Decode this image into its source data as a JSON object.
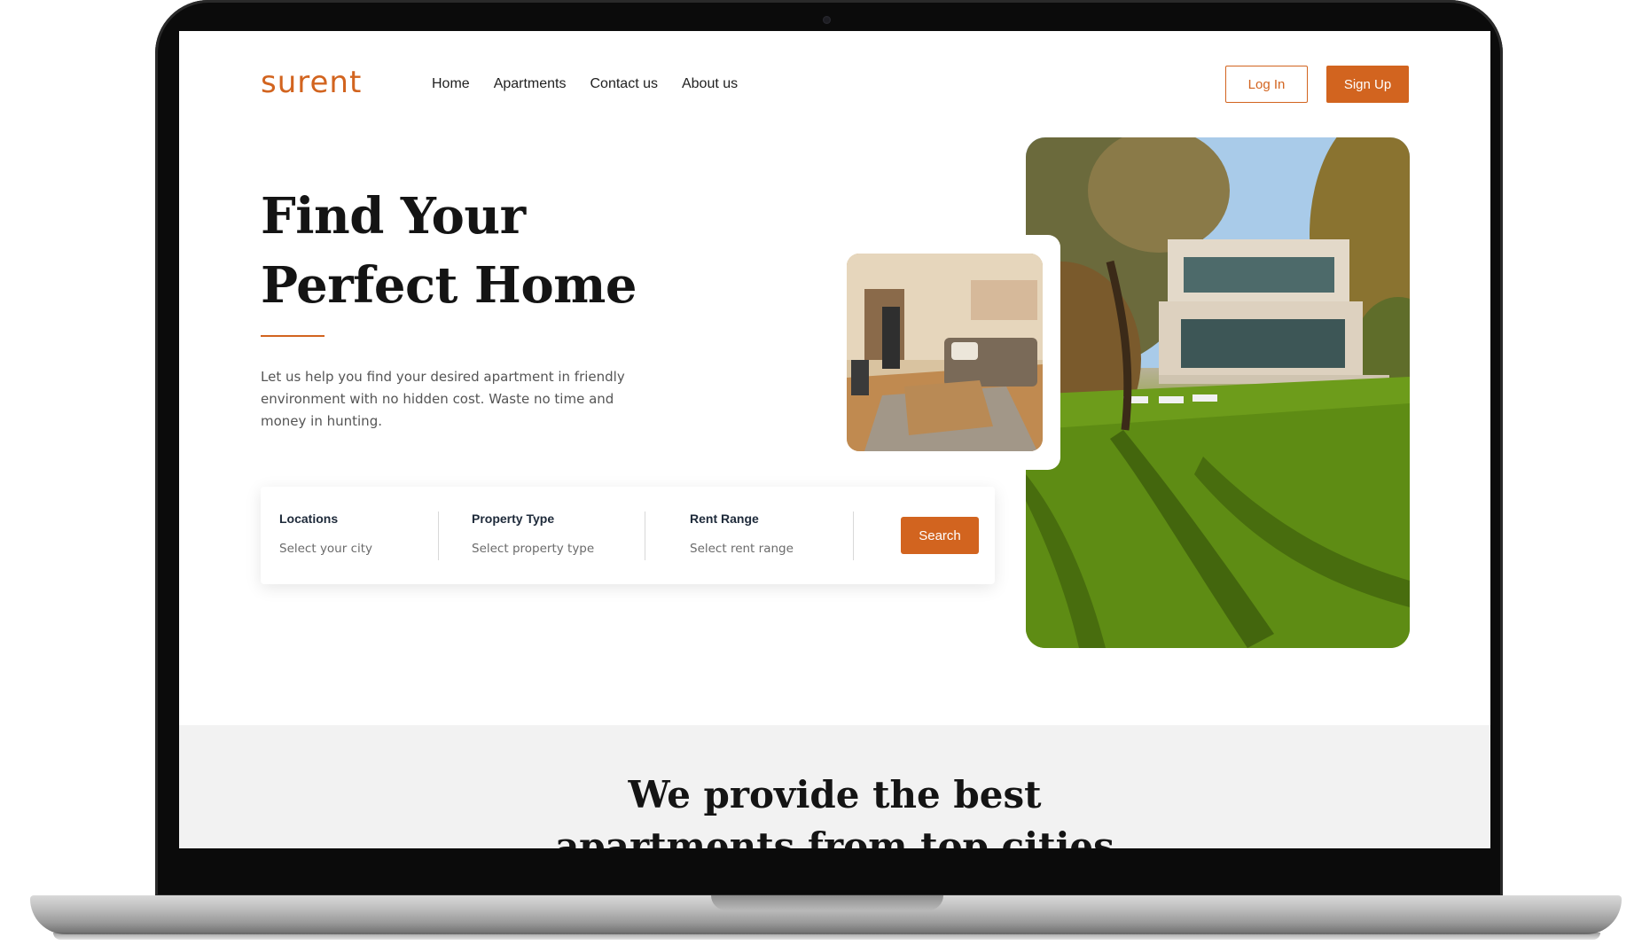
{
  "brand": {
    "logo": "surent",
    "accent_color": "#d2641f"
  },
  "nav": {
    "items": [
      {
        "label": "Home"
      },
      {
        "label": "Apartments"
      },
      {
        "label": "Contact us"
      },
      {
        "label": "About us"
      }
    ]
  },
  "auth": {
    "login_label": "Log In",
    "signup_label": "Sign Up"
  },
  "hero": {
    "title_line1": "Find Your",
    "title_line2": "Perfect Home",
    "description": "Let us help you find your desired apartment in friendly environment with no hidden cost. Waste no time and money in hunting."
  },
  "search": {
    "location": {
      "label": "Locations",
      "placeholder": "Select your city"
    },
    "property_type": {
      "label": "Property Type",
      "placeholder": "Select property type"
    },
    "rent_range": {
      "label": "Rent Range",
      "placeholder": "Select rent range"
    },
    "button_label": "Search"
  },
  "images": {
    "house": "house-exterior-photo",
    "interior": "living-room-interior-photo"
  },
  "section_two": {
    "title_line1": "We provide the best",
    "title_line2": "apartments from top cities"
  }
}
